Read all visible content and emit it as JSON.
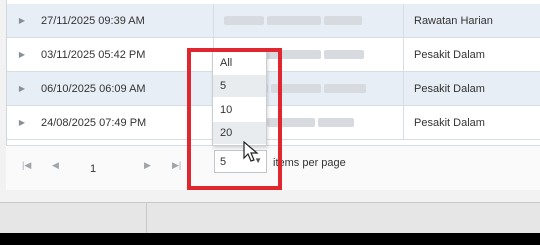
{
  "rows": [
    {
      "date": "27/11/2025 09:39 AM",
      "type": "Rawatan Harian"
    },
    {
      "date": "03/11/2025 05:42 PM",
      "type": "Pesakit Dalam"
    },
    {
      "date": "06/10/2025 06:09 AM",
      "type": "Pesakit Dalam"
    },
    {
      "date": "24/08/2025 07:49 PM",
      "type": "Pesakit Dalam"
    }
  ],
  "pager": {
    "first_icon": "first-page-icon",
    "prev_icon": "prev-page-icon",
    "page": "1",
    "next_icon": "next-page-icon",
    "last_icon": "last-page-icon",
    "page_size": "5",
    "per_page_label": "items per page"
  },
  "dropdown": {
    "options": [
      "All",
      "5",
      "10",
      "20"
    ],
    "selected": "5"
  },
  "colors": {
    "accent": "#1f87e5",
    "highlight_box": "#e0262f",
    "alt_row": "#e8eef6"
  }
}
